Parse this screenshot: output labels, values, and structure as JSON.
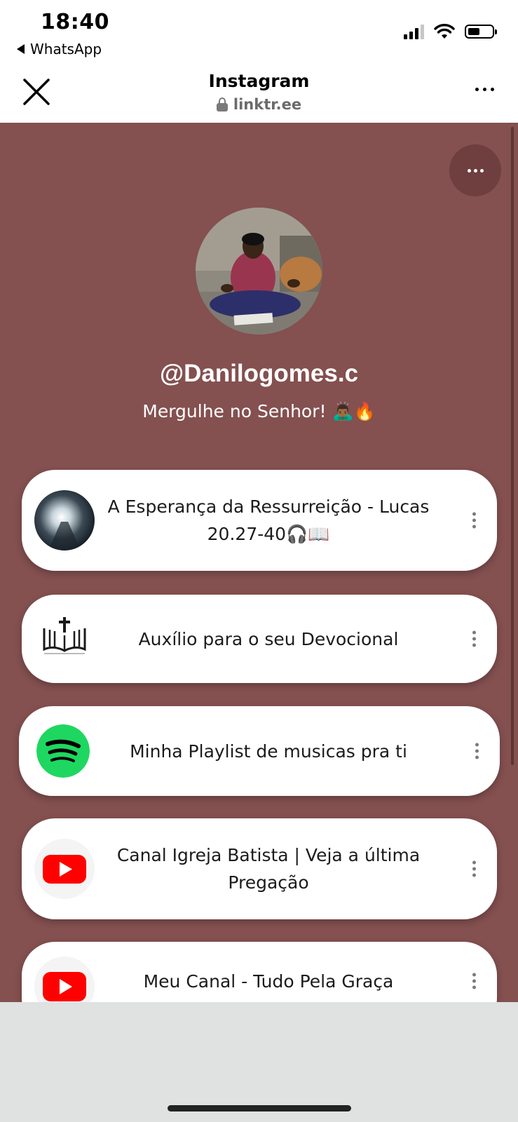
{
  "status_bar": {
    "time": "18:40",
    "back_app": "WhatsApp"
  },
  "browser": {
    "title": "Instagram",
    "url": "linktr.ee"
  },
  "profile": {
    "username": "@Danilogomes.c",
    "bio": "Mergulhe no Senhor! 🙇🏾‍♂️🔥"
  },
  "links": [
    {
      "label": "A Esperança da Ressurreição - Lucas 20.27-40🎧📖",
      "icon": "tunnel-light-thumbnail"
    },
    {
      "label": "Auxílio para o seu Devocional",
      "icon": "bible-cross-icon"
    },
    {
      "label": "Minha Playlist de musicas pra ti",
      "icon": "spotify-icon"
    },
    {
      "label": "Canal Igreja Batista | Veja a última Pregação",
      "icon": "youtube-icon"
    },
    {
      "label": "Meu Canal - Tudo Pela Graça",
      "icon": "youtube-icon"
    }
  ],
  "colors": {
    "page_background": "#845050",
    "card_background": "#ffffff",
    "spotify_green": "#1ed760",
    "youtube_red": "#ff0000"
  }
}
